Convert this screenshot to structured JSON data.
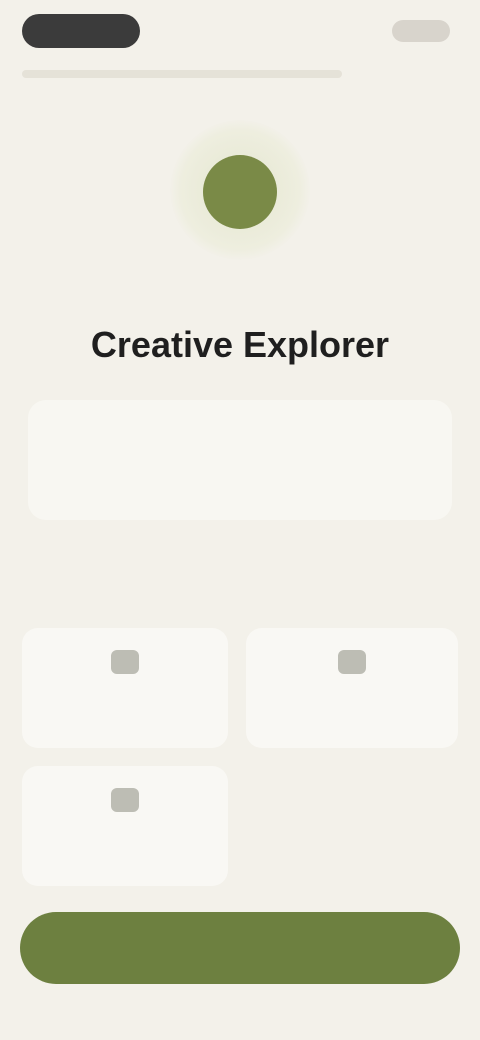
{
  "header": {
    "status_label": "",
    "action_label": ""
  },
  "hero": {
    "caption": "",
    "title": "Creative Explorer",
    "description": ""
  },
  "section": {
    "title": ""
  },
  "cards": [
    {
      "icon": "category-icon",
      "label": ""
    },
    {
      "icon": "category-icon",
      "label": ""
    },
    {
      "icon": "category-icon",
      "label": ""
    }
  ],
  "cta": {
    "label": ""
  },
  "colors": {
    "accent": "#6d8040",
    "hero_dot": "#7a8a47",
    "background": "#f3f1ea"
  }
}
